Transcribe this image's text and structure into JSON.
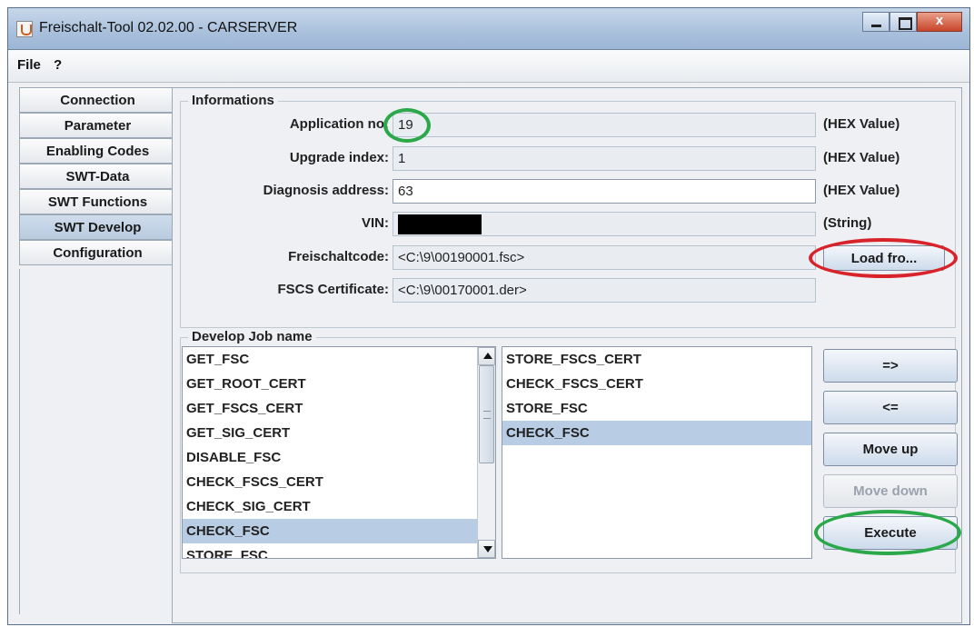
{
  "window": {
    "title": "Freischalt-Tool 02.02.00 - CARSERVER"
  },
  "menu": {
    "file": "File",
    "help": "?"
  },
  "tabs": [
    {
      "label": "Connection",
      "selected": false
    },
    {
      "label": "Parameter",
      "selected": false
    },
    {
      "label": "Enabling Codes",
      "selected": false
    },
    {
      "label": "SWT-Data",
      "selected": false
    },
    {
      "label": "SWT Functions",
      "selected": false
    },
    {
      "label": "SWT Develop",
      "selected": true
    },
    {
      "label": "Configuration",
      "selected": false
    }
  ],
  "informations": {
    "title": "Informations",
    "application_no": {
      "label": "Application no:",
      "value": "19",
      "hint": "(HEX Value)"
    },
    "upgrade_index": {
      "label": "Upgrade index:",
      "value": "1",
      "hint": "(HEX Value)"
    },
    "diagnosis_address": {
      "label": "Diagnosis address:",
      "value": "63",
      "hint": "(HEX Value)"
    },
    "vin": {
      "label": "VIN:",
      "value": "",
      "hint": "(String)"
    },
    "freischaltcode": {
      "label": "Freischaltcode:",
      "value": "<C:\\9\\00190001.fsc>"
    },
    "fscs_certificate": {
      "label": "FSCS Certificate:",
      "value": "<C:\\9\\00170001.der>"
    },
    "load_button": "Load fro..."
  },
  "develop": {
    "title": "Develop Job name",
    "available_jobs": [
      {
        "label": "GET_FSC",
        "selected": false
      },
      {
        "label": "GET_ROOT_CERT",
        "selected": false
      },
      {
        "label": "GET_FSCS_CERT",
        "selected": false
      },
      {
        "label": "GET_SIG_CERT",
        "selected": false
      },
      {
        "label": "DISABLE_FSC",
        "selected": false
      },
      {
        "label": "CHECK_FSCS_CERT",
        "selected": false
      },
      {
        "label": "CHECK_SIG_CERT",
        "selected": false
      },
      {
        "label": "CHECK_FSC",
        "selected": true
      },
      {
        "label": "STORE_FSC",
        "selected": false
      }
    ],
    "selected_jobs": [
      {
        "label": "STORE_FSCS_CERT",
        "selected": false
      },
      {
        "label": "CHECK_FSCS_CERT",
        "selected": false
      },
      {
        "label": "STORE_FSC",
        "selected": false
      },
      {
        "label": "CHECK_FSC",
        "selected": true
      }
    ],
    "buttons": {
      "add": "=>",
      "remove": "<=",
      "move_up": "Move up",
      "move_down": "Move down",
      "execute": "Execute"
    },
    "move_down_enabled": false
  },
  "annotations": {
    "green": "#2aa84a",
    "red": "#d8232a"
  }
}
